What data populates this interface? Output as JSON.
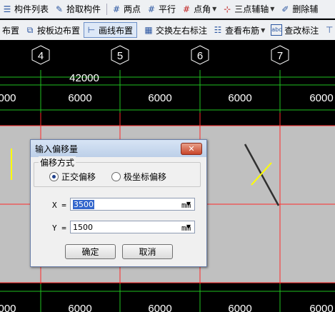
{
  "toolbar1": {
    "items": [
      {
        "label": "构件列表",
        "icon": "list-icon"
      },
      {
        "label": "拾取构件",
        "icon": "pick-icon"
      },
      {
        "label": "两点",
        "icon": "two-point-axis-icon"
      },
      {
        "label": "平行",
        "icon": "parallel-axis-icon"
      },
      {
        "label": "点角",
        "icon": "point-angle-axis-icon"
      },
      {
        "label": "三点辅轴",
        "icon": "three-point-axis-icon"
      },
      {
        "label": "删除辅",
        "icon": "delete-axis-icon"
      }
    ]
  },
  "toolbar2": {
    "items": [
      {
        "label": "布置",
        "icon": ""
      },
      {
        "label": "按板边布置",
        "icon": "slab-edge-icon"
      },
      {
        "label": "画线布置",
        "icon": "draw-line-icon",
        "active": true
      },
      {
        "label": "交换左右标注",
        "icon": "swap-label-icon"
      },
      {
        "label": "查看布筋",
        "icon": "view-rebar-icon"
      },
      {
        "label": "查改标注",
        "icon": "edit-label-icon"
      }
    ]
  },
  "drawing": {
    "axes": [
      "4",
      "5",
      "6",
      "7"
    ],
    "total_dimension": "42000",
    "top_dims": [
      "000",
      "6000",
      "6000",
      "6000",
      "6000"
    ],
    "bottom_dims": [
      "000",
      "6000",
      "6000",
      "6000",
      "6000"
    ],
    "colors": {
      "grid": "#ff2a2a",
      "slab": "#c0c0c0",
      "dim": "#20c020",
      "accent": "#ffff00"
    }
  },
  "dialog": {
    "title": "输入偏移量",
    "close_label": "✕",
    "group_label": "偏移方式",
    "radio_orthogonal": "正交偏移",
    "radio_polar": "极坐标偏移",
    "x_label": "X =",
    "x_value": "3500",
    "y_label": "Y =",
    "y_value": "1500",
    "unit": "mm",
    "ok_label": "确定",
    "cancel_label": "取消"
  }
}
